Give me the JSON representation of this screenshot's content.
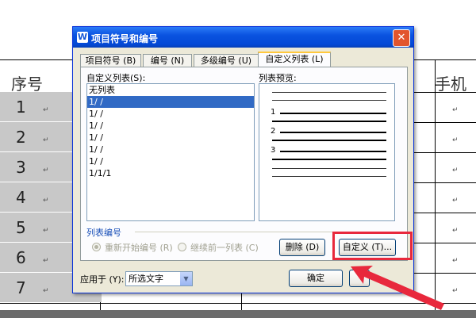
{
  "document": {
    "col_header_left": "序号",
    "col_header_right": "手机",
    "rows": [
      "1",
      "2",
      "3",
      "4",
      "5",
      "6",
      "7"
    ],
    "para_mark": "↵"
  },
  "dialog": {
    "title": "项目符号和编号",
    "close": "✕",
    "tabs": [
      "项目符号 (B)",
      "编号 (N)",
      "多级编号 (U)",
      "自定义列表 (L)"
    ],
    "custom_list_label": "自定义列表(S):",
    "list_items": [
      "无列表",
      "1/   /",
      "1/   /",
      "1/   /",
      "1/   /",
      "1/   /",
      "1/   /",
      "1/1/1"
    ],
    "preview_label": "列表预览:",
    "preview_numbers": [
      "1",
      "2",
      "3"
    ],
    "group_label": "列表编号",
    "radio_restart": "重新开始编号 (R)",
    "radio_continue": "继续前一列表 (C)",
    "delete_button": "删除 (D)",
    "customize_button": "自定义 (T)...",
    "apply_to_label": "应用于 (Y):",
    "apply_to_value": "所选文字",
    "ok_button": "确定",
    "highlight_color": "#e8283c",
    "title_bar_color": "#0a53e0"
  }
}
